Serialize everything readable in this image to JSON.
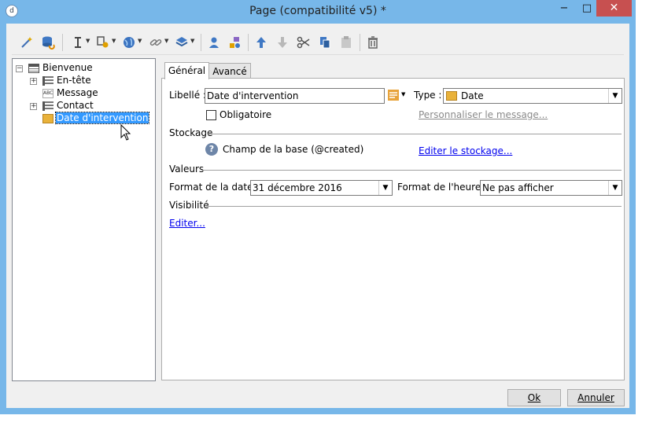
{
  "window": {
    "title": "Page (compatibilité v5) *",
    "app_icon": "d",
    "minimize": "−",
    "maximize": "□",
    "close": "✕"
  },
  "toolbar": {
    "icons": [
      "wand-icon",
      "database-sync-icon",
      "text-cursor-icon",
      "settings-icon",
      "globe-icon",
      "link-icon",
      "stack-icon",
      "person-icon",
      "shapes-icon",
      "arrow-up-icon",
      "arrow-down-icon",
      "cut-icon",
      "copy-icon",
      "paste-icon",
      "trash-icon"
    ]
  },
  "tree": {
    "root": "Bienvenue",
    "items": [
      "En-tête",
      "Message",
      "Contact",
      "Date d'intervention"
    ],
    "selected": "Date d'intervention"
  },
  "tabs": [
    "Général",
    "Avancé"
  ],
  "general": {
    "label_caption": "Libellé :",
    "label_value": "Date d'intervention",
    "type_caption": "Type :",
    "type_value": "Date",
    "mandatory_label": "Obligatoire",
    "mandatory_checked": false,
    "customize_message_link": "Personnaliser le message...",
    "storage_section": "Stockage",
    "storage_text": "Champ de la base (@created)",
    "edit_storage_link": "Editer le stockage...",
    "values_section": "Valeurs",
    "date_format_caption": "Format de la date :",
    "date_format_value": "31 décembre 2016",
    "time_format_caption": "Format de l'heure :",
    "time_format_value": "Ne pas afficher",
    "visibility_section": "Visibilité",
    "edit_visibility_link": "Editer..."
  },
  "buttons": {
    "ok": "Ok",
    "cancel": "Annuler"
  },
  "colors": {
    "titlebar": "#77b7e9",
    "close_button": "#c75050",
    "selection": "#3399ff",
    "link": "#0000ee",
    "date_icon": "#e9b23a"
  }
}
